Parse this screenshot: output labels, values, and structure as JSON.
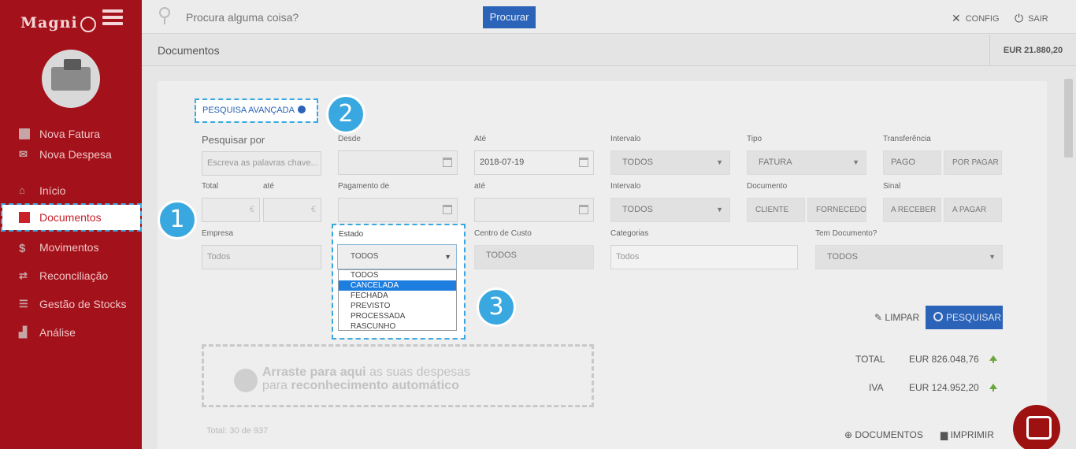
{
  "sidebar": {
    "logo": "Magni",
    "items": [
      {
        "label": "Nova Fatura"
      },
      {
        "label": "Nova Despesa"
      },
      {
        "label": "Início"
      },
      {
        "label": "Documentos"
      },
      {
        "label": "Movimentos"
      },
      {
        "label": "Reconciliação"
      },
      {
        "label": "Gestão de Stocks"
      },
      {
        "label": "Análise"
      }
    ]
  },
  "topbar": {
    "search_placeholder": "Procura alguma coisa?",
    "search_button": "Procurar",
    "config": "CONFIG",
    "sair": "SAIR"
  },
  "breadcrumb": {
    "title": "Documentos",
    "balance": "EUR 21.880,20"
  },
  "advanced_search": "PESQUISA AVANÇADA",
  "badges": [
    "1",
    "2",
    "3"
  ],
  "form": {
    "pesquisar_por": "Pesquisar por",
    "keywords_placeholder": "Escreva as palavras chave...",
    "desde": "Desde",
    "ate": "Até",
    "ate_value": "2018-07-19",
    "intervalo": "Intervalo",
    "intervalo_value": "TODOS",
    "tipo": "Tipo",
    "tipo_value": "FATURA",
    "transferencia": "Transferência",
    "transferencia_options": [
      "PAGO",
      "POR PAGAR"
    ],
    "total": "Total",
    "ate_lower": "até",
    "pagamento_de": "Pagamento de",
    "ate_lower2": "até",
    "intervalo2": "Intervalo",
    "intervalo2_value": "TODOS",
    "documento": "Documento",
    "documento_options": [
      "CLIENTE",
      "FORNECEDOR"
    ],
    "sinal": "Sinal",
    "sinal_options": [
      "A RECEBER",
      "A PAGAR"
    ],
    "empresa": "Empresa",
    "empresa_value": "Todos",
    "estado": "Estado",
    "estado_value": "TODOS",
    "estado_options": [
      "TODOS",
      "CANCELADA",
      "FECHADA",
      "PREVISTO",
      "PROCESSADA",
      "RASCUNHO"
    ],
    "centro_custo": "Centro de Custo",
    "centro_custo_value": "TODOS",
    "categorias": "Categorias",
    "categorias_value": "Todos",
    "tem_documento": "Tem Documento?",
    "tem_documento_value": "TODOS"
  },
  "actions": {
    "limpar": "LIMPAR",
    "pesquisar": "PESQUISAR"
  },
  "dropzone": {
    "line1_bold": "Arraste para aqui",
    "line1_rest": " as suas despesas",
    "line2_start": "para ",
    "line2_bold": "reconhecimento automático"
  },
  "totals": {
    "total_label": "TOTAL",
    "total_value": "EUR 826.048,76",
    "iva_label": "IVA",
    "iva_value": "EUR 124.952,20"
  },
  "footer": {
    "count": "Total: 30 de 937",
    "documentos": "DOCUMENTOS",
    "imprimir": "IMPRIMIR"
  },
  "colors": {
    "sidebar": "#a3111a",
    "accent_blue": "#2a63b7",
    "highlight": "#3aa8e0"
  }
}
